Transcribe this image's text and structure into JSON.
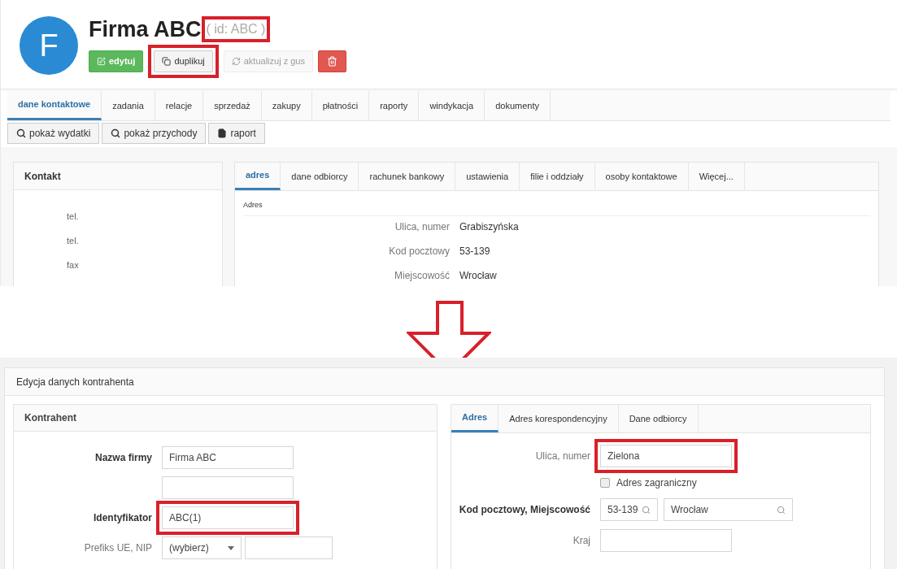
{
  "top_screen": {
    "avatar_letter": "F",
    "title": "Firma ABC",
    "id_label": {
      "text": "( id: ABC )",
      "highlighted": true
    },
    "actions": [
      {
        "kind": "edit",
        "label": "edytuj",
        "disabled": false,
        "highlighted": false
      },
      {
        "kind": "duplicate",
        "label": "duplikuj",
        "disabled": false,
        "highlighted": true
      },
      {
        "kind": "refresh",
        "label": "aktualizuj z gus",
        "disabled": true,
        "highlighted": false
      },
      {
        "kind": "delete",
        "disabled": false,
        "highlighted": false
      }
    ],
    "tabs": [
      {
        "label": "dane kontaktowe",
        "selected": true
      },
      {
        "label": "zadania",
        "selected": false
      },
      {
        "label": "relacje",
        "selected": false
      },
      {
        "label": "sprzedaż",
        "selected": false
      },
      {
        "label": "zakupy",
        "selected": false
      },
      {
        "label": "płatności",
        "selected": false
      },
      {
        "label": "raporty",
        "selected": false
      },
      {
        "label": "windykacja",
        "selected": false
      },
      {
        "label": "dokumenty",
        "selected": false
      }
    ],
    "toolbar": [
      {
        "kind": "search",
        "label": "pokaż wydatki"
      },
      {
        "kind": "search",
        "label": "pokaż przychody"
      },
      {
        "kind": "file",
        "label": "raport"
      }
    ],
    "contact_panel": {
      "title": "Kontakt",
      "rows": [
        "tel.",
        "tel.",
        "fax"
      ]
    },
    "detail_panel": {
      "tabs": [
        {
          "label": "adres",
          "selected": true
        },
        {
          "label": "dane odbiorcy",
          "selected": false
        },
        {
          "label": "rachunek bankowy",
          "selected": false
        },
        {
          "label": "ustawienia",
          "selected": false
        },
        {
          "label": "filie i oddziały",
          "selected": false
        },
        {
          "label": "osoby kontaktowe",
          "selected": false
        },
        {
          "label": "Więcej...",
          "selected": false
        }
      ],
      "section": "Adres",
      "rows": [
        {
          "label": "Ulica, numer",
          "value": "Grabiszyńska"
        },
        {
          "label": "Kod pocztowy",
          "value": "53-139"
        },
        {
          "label": "Miejscowość",
          "value": "Wrocław"
        }
      ]
    }
  },
  "bottom_screen": {
    "title": "Edycja danych kontrahenta",
    "contractor_panel": {
      "title": "Kontrahent",
      "fields": [
        {
          "kind": "text",
          "label": "Nazwa firmy",
          "bold": true,
          "value": "Firma ABC",
          "highlighted": false
        },
        {
          "kind": "text",
          "highlighted": false
        },
        {
          "kind": "text",
          "label": "Identyfikator",
          "bold": true,
          "value": "ABC(1)",
          "highlighted": true
        },
        {
          "kind": "select_text",
          "label": "Prefiks UE, NIP",
          "bold": false,
          "value": "(wybierz)"
        }
      ]
    },
    "address_panel": {
      "tabs": [
        {
          "label": "Adres",
          "selected": true
        },
        {
          "label": "Adres korespondencyjny",
          "selected": false
        },
        {
          "label": "Dane odbiorcy",
          "selected": false
        }
      ],
      "fields": [
        {
          "kind": "text",
          "label": "Ulica, numer",
          "bold": false,
          "value": "Zielona",
          "highlighted": true
        },
        {
          "kind": "checkbox",
          "label": "Adres zagraniczny",
          "checked": false
        },
        {
          "kind": "postal",
          "label": "Kod pocztowy, Miejscowość",
          "bold": true,
          "values": [
            "53-139",
            "Wrocław"
          ]
        },
        {
          "kind": "text",
          "label": "Kraj",
          "bold": false,
          "highlighted": false
        }
      ]
    }
  }
}
